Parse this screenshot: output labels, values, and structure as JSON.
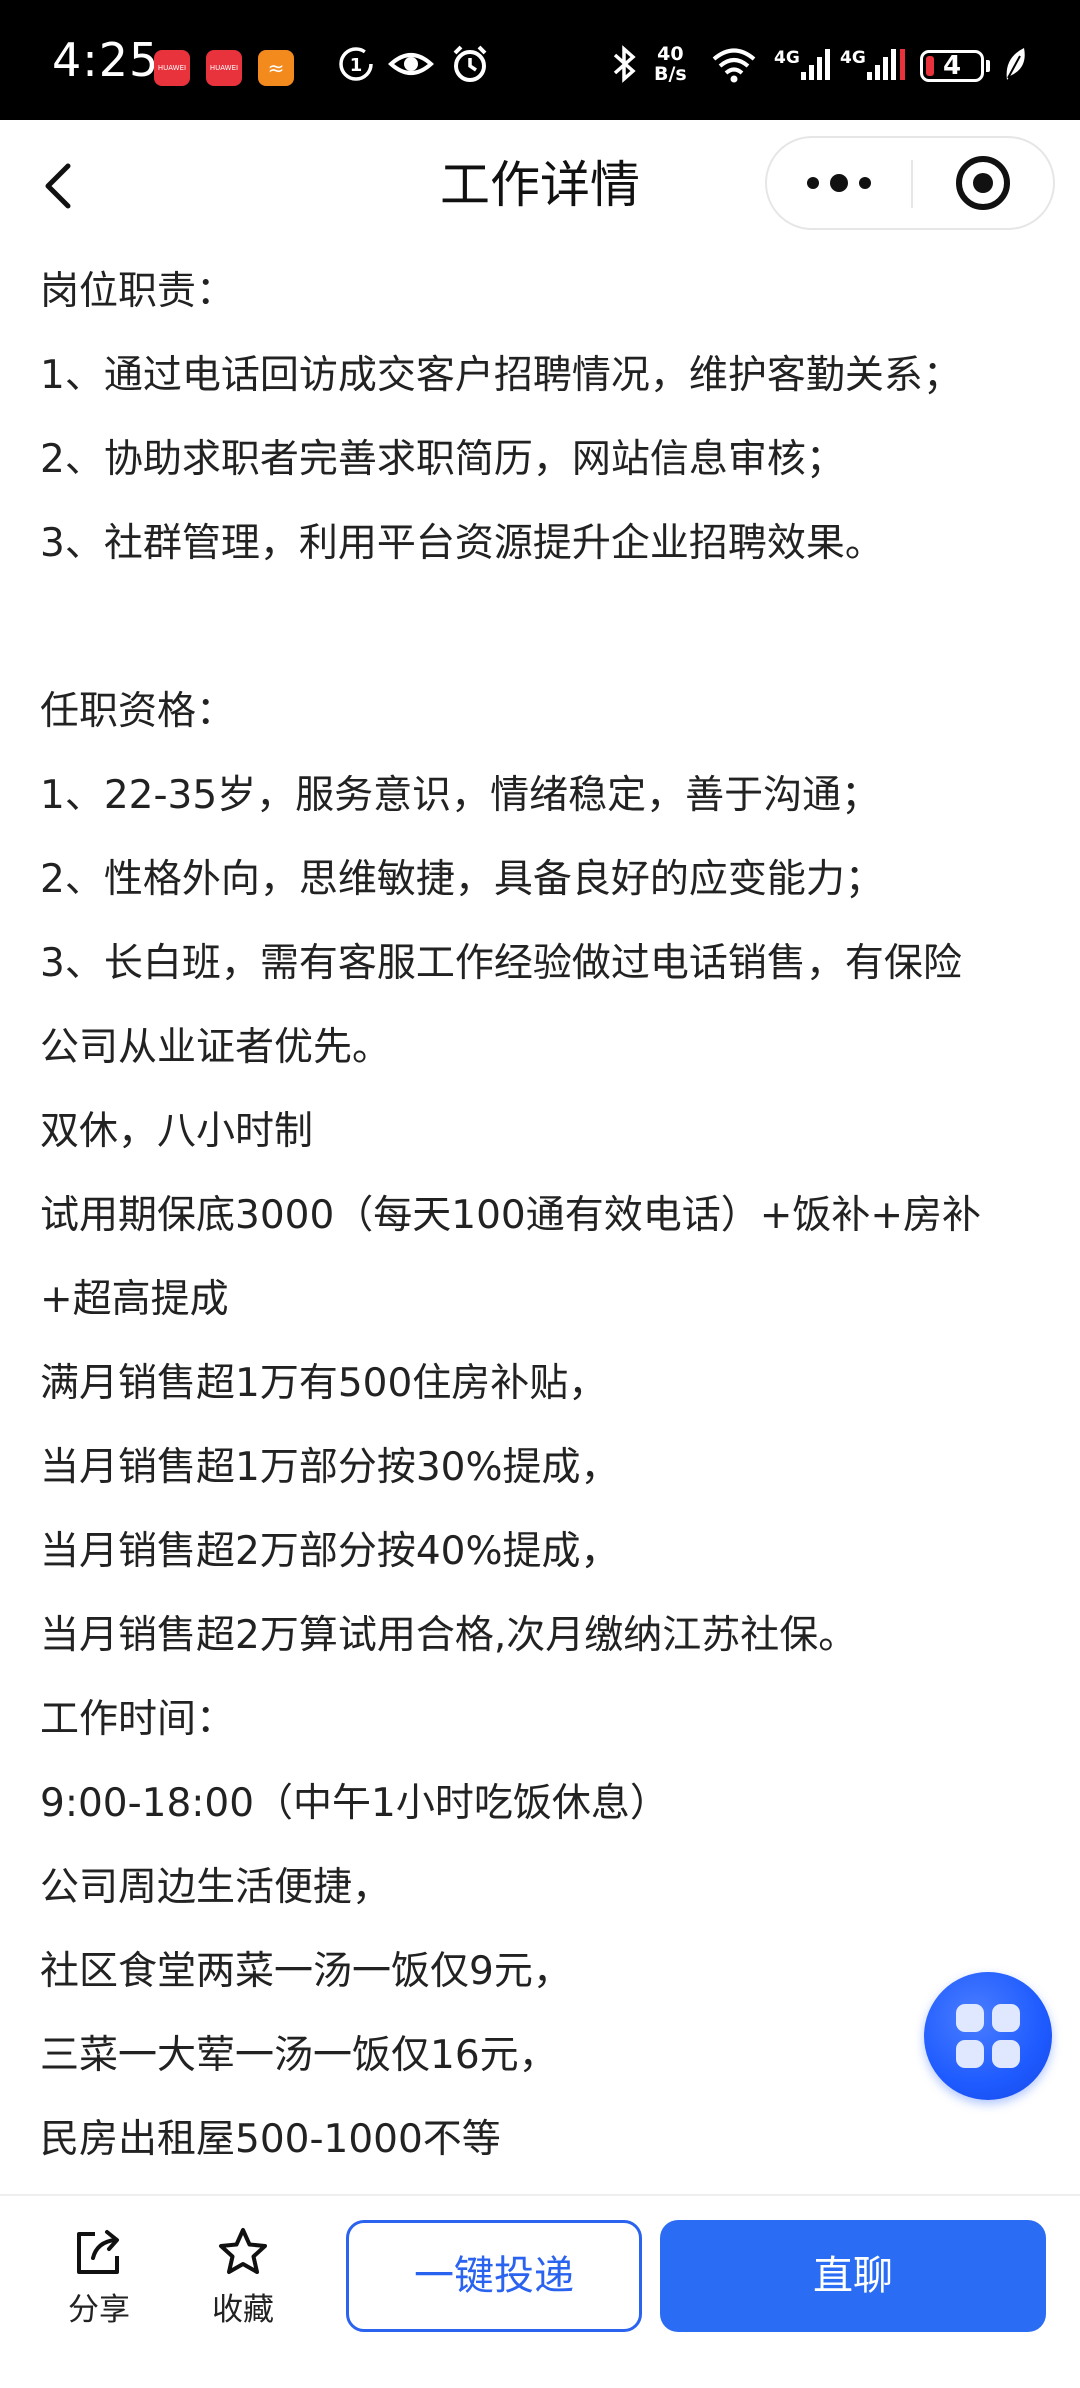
{
  "status_bar": {
    "time": "4:25",
    "app_badge_1": "HUAWEI",
    "app_badge_2": "HUAWEI",
    "net_speed_value": "40",
    "net_speed_unit": "B/s",
    "signal_1_label": "4G",
    "signal_2_label": "4G",
    "battery_level": "4",
    "icons": [
      "huawei-app-icon",
      "huawei-app-icon",
      "orange-app-icon",
      "data-saver-icon",
      "eye-icon",
      "alarm-icon",
      "bluetooth-icon",
      "wifi-icon",
      "signal-icon",
      "signal-icon",
      "battery-icon",
      "leaf-icon"
    ]
  },
  "nav": {
    "title": "工作详情",
    "back_icon": "chevron-left-icon",
    "more_icon": "more-dots-icon",
    "close_icon": "target-close-icon"
  },
  "content": {
    "lines": [
      "岗位职责：",
      "1、通过电话回访成交客户招聘情况，维护客勤关系；",
      "2、协助求职者完善求职简历，网站信息审核；",
      "3、社群管理，利用平台资源提升企业招聘效果。",
      "",
      "任职资格：",
      "1、22-35岁，服务意识，情绪稳定，善于沟通；",
      "2、性格外向，思维敏捷，具备良好的应变能力；",
      "3、长白班，需有客服工作经验做过电话销售，有保险",
      "公司从业证者优先。",
      "双休，八小时制",
      "试用期保底3000（每天100通有效电话）+饭补+房补",
      "+超高提成",
      "满月销售超1万有500住房补贴，",
      "当月销售超1万部分按30%提成，",
      "当月销售超2万部分按40%提成，",
      "当月销售超2万算试用合格,次月缴纳江苏社保。",
      "工作时间：",
      "9:00-18:00（中午1小时吃饭休息）",
      "公司周边生活便捷，",
      "社区食堂两菜一汤一饭仅9元，",
      "三菜一大荤一汤一饭仅16元，",
      "民房出租屋500-1000不等"
    ]
  },
  "bottom_bar": {
    "share_label": "分享",
    "favorite_label": "收藏",
    "apply_label": "一键投递",
    "chat_label": "直聊"
  },
  "colors": {
    "primary": "#2a6df4",
    "outline": "#2a63f0",
    "text": "#222222",
    "status_bar_bg": "#000000"
  }
}
